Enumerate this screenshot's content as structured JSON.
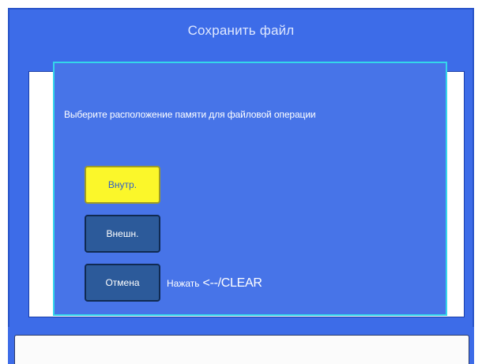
{
  "header": {
    "title": "Сохранить файл"
  },
  "dialog": {
    "prompt": "Выберите расположение памяти для файловой операции",
    "buttons": [
      {
        "label": "Внутр.",
        "state": "selected"
      },
      {
        "label": "Внешн.",
        "state": "normal"
      },
      {
        "label": "Отмена",
        "state": "normal"
      }
    ],
    "hint": {
      "label": "Нажать",
      "key": "<--/CLEAR"
    }
  },
  "colors": {
    "background_blue": "#3d6ce8",
    "dialog_blue": "#4774e8",
    "dialog_border": "#34d6ea",
    "selected_button": "#fbf72a",
    "normal_button": "#2c5a9a"
  }
}
